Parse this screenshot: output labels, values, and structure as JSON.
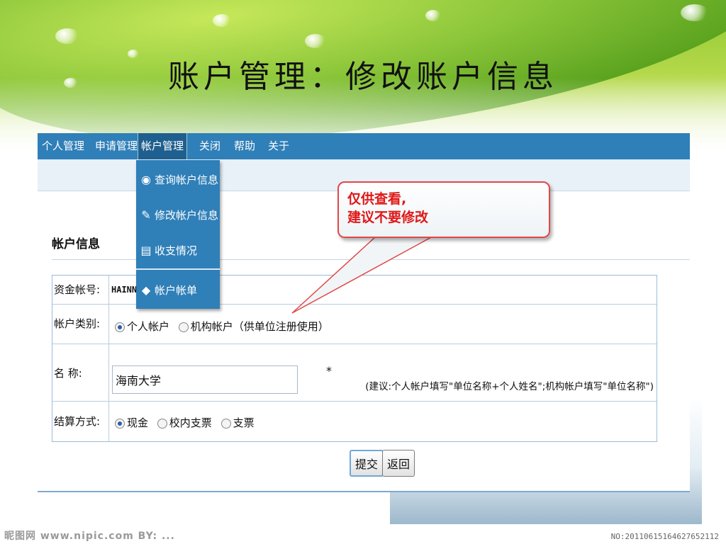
{
  "slide": {
    "title": "账户管理：修改账户信息"
  },
  "menubar": {
    "items": [
      "个人管理",
      "申请管理",
      "帐户管理",
      "关闭",
      "帮助",
      "关于"
    ]
  },
  "dropdown": {
    "items": [
      {
        "label": "查询帐户信息",
        "icon": "binoculars-icon"
      },
      {
        "label": "修改帐户信息",
        "icon": "pencil-icon"
      },
      {
        "label": "收支情况",
        "icon": "book-icon"
      },
      {
        "label": "帐户帐单",
        "icon": "diamond-icon"
      }
    ]
  },
  "section": {
    "title": "帐户信息"
  },
  "form": {
    "account_no_label": "资金帐号:",
    "account_no_value": "HAINN2",
    "account_type_label": "帐户类别:",
    "account_type_options": [
      "个人帐户",
      "机构帐户（供单位注册使用）"
    ],
    "account_type_selected": "个人帐户",
    "name_label": "名 称:",
    "name_value": "海南大学",
    "required_mark": "*",
    "name_hint": "(建议:个人帐户填写\"单位名称+个人姓名\";机构帐户填写\"单位名称\")",
    "settlement_label": "结算方式:",
    "settlement_options": [
      "现金",
      "校内支票",
      "支票"
    ],
    "settlement_selected": "现金"
  },
  "buttons": {
    "submit": "提交",
    "back": "返回"
  },
  "callout": {
    "line1": "仅供查看,",
    "line2": "建议不要修改"
  },
  "watermark": {
    "left": "昵图网 www.nipic.com   BY: ...",
    "right": "NO:20110615164627652112"
  },
  "colors": {
    "menubar": "#2f7fb8",
    "callout_text": "#e01818",
    "callout_border": "#e04848"
  }
}
